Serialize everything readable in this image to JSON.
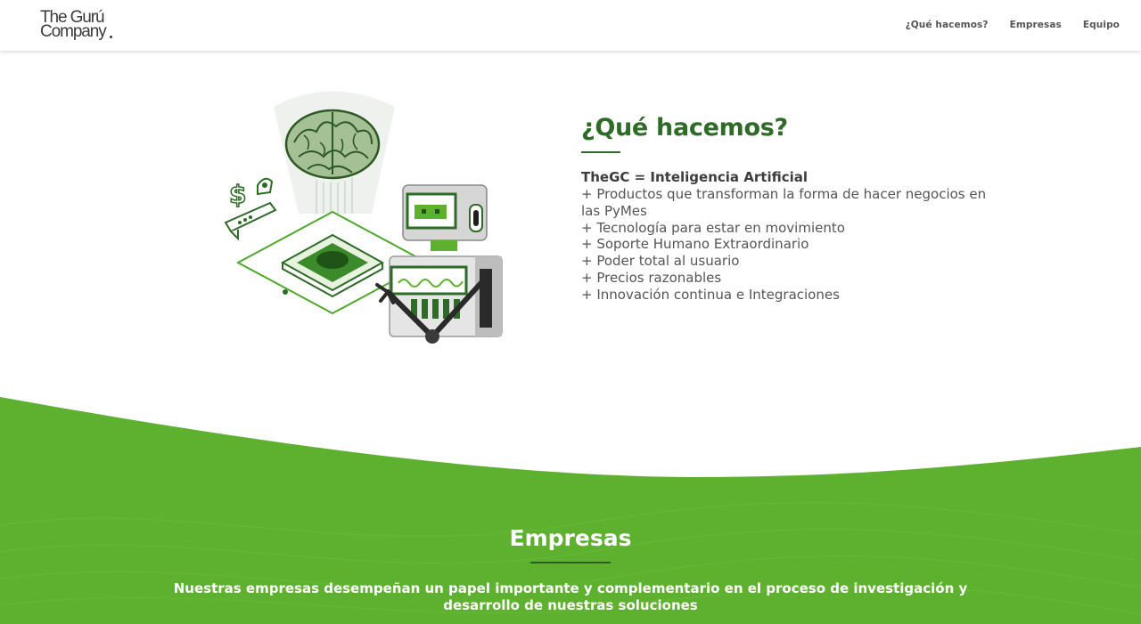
{
  "header": {
    "logo_line1": "The Gurú",
    "logo_line2": "Company",
    "nav": [
      {
        "label": "¿Qué hacemos?"
      },
      {
        "label": "Empresas"
      },
      {
        "label": "Equipo"
      }
    ]
  },
  "que_hacemos": {
    "title": "¿Qué hacemos?",
    "lead": "TheGC = Inteligencia Artificial",
    "items": [
      "+ Productos que transforman la forma de hacer negocios en las PyMes",
      "+ Tecnología para estar en movimiento",
      "+ Soporte Humano Extraordinario",
      "+ Poder total al usuario",
      "+ Precios razonables",
      "+ Innovación continua e Integraciones"
    ]
  },
  "illustration": {
    "icon": "ai-brain-robot-chip-illustration"
  },
  "empresas": {
    "title": "Empresas",
    "text": "Nuestras empresas desempeñan un papel importante y complementario en el proceso de investigación y desarrollo de nuestras soluciones"
  },
  "colors": {
    "brand_green": "#5eb12e",
    "title_green": "#2e6b27"
  }
}
